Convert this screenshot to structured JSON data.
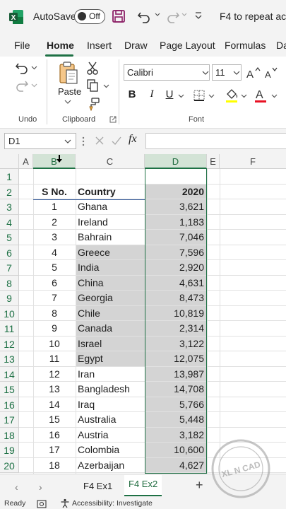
{
  "titlebar": {
    "autosave_label": "AutoSave",
    "autosave_state": "Off",
    "doc_title": "F4 to repeat ac"
  },
  "ribbon_tabs": [
    "File",
    "Home",
    "Insert",
    "Draw",
    "Page Layout",
    "Formulas",
    "Da"
  ],
  "active_tab": "Home",
  "ribbon": {
    "undo_group": "Undo",
    "clipboard_group": "Clipboard",
    "paste_label": "Paste",
    "font_group": "Font",
    "font_name": "Calibri",
    "font_size": "11",
    "bold": "B",
    "italic": "I",
    "underline": "U"
  },
  "formula_bar": {
    "name_box": "D1",
    "fx": "fx",
    "formula": ""
  },
  "grid": {
    "columns": [
      "A",
      "B",
      "C",
      "D",
      "E",
      "F"
    ],
    "selected_column": "D",
    "header_row": {
      "sno": "S No.",
      "country": "Country",
      "year": "2020"
    },
    "row_numbers": [
      "1",
      "2",
      "3",
      "4",
      "5",
      "6",
      "7",
      "8",
      "9",
      "10",
      "11",
      "12",
      "13",
      "14",
      "15",
      "16",
      "17",
      "18",
      "19",
      "20"
    ],
    "rows": [
      {
        "sno": "1",
        "country": "Ghana",
        "value": "3,621"
      },
      {
        "sno": "2",
        "country": "Ireland",
        "value": "1,183"
      },
      {
        "sno": "3",
        "country": "Bahrain",
        "value": "7,046"
      },
      {
        "sno": "4",
        "country": "Greece",
        "value": "7,596"
      },
      {
        "sno": "5",
        "country": "India",
        "value": "2,920"
      },
      {
        "sno": "6",
        "country": "China",
        "value": "4,631"
      },
      {
        "sno": "7",
        "country": "Georgia",
        "value": "8,473"
      },
      {
        "sno": "8",
        "country": "Chile",
        "value": "10,819"
      },
      {
        "sno": "9",
        "country": "Canada",
        "value": "2,314"
      },
      {
        "sno": "10",
        "country": "Israel",
        "value": "3,122"
      },
      {
        "sno": "11",
        "country": "Egypt",
        "value": "12,075"
      },
      {
        "sno": "12",
        "country": "Iran",
        "value": "13,987"
      },
      {
        "sno": "13",
        "country": "Bangladesh",
        "value": "14,708"
      },
      {
        "sno": "14",
        "country": "Iraq",
        "value": "5,766"
      },
      {
        "sno": "15",
        "country": "Australia",
        "value": "5,448"
      },
      {
        "sno": "16",
        "country": "Austria",
        "value": "3,182"
      },
      {
        "sno": "17",
        "country": "Colombia",
        "value": "10,600"
      },
      {
        "sno": "18",
        "country": "Azerbaijan",
        "value": "4,627"
      }
    ]
  },
  "sheets": [
    "F4 Ex1",
    "F4 Ex2"
  ],
  "active_sheet": "F4 Ex2",
  "status": {
    "ready": "Ready",
    "accessibility": "Accessibility: Investigate"
  },
  "watermark_text": "XL N CAD",
  "colors": {
    "excel_green": "#1e7145",
    "selection_fill": "#d4d4d4",
    "font_color_red": "#e81123"
  }
}
